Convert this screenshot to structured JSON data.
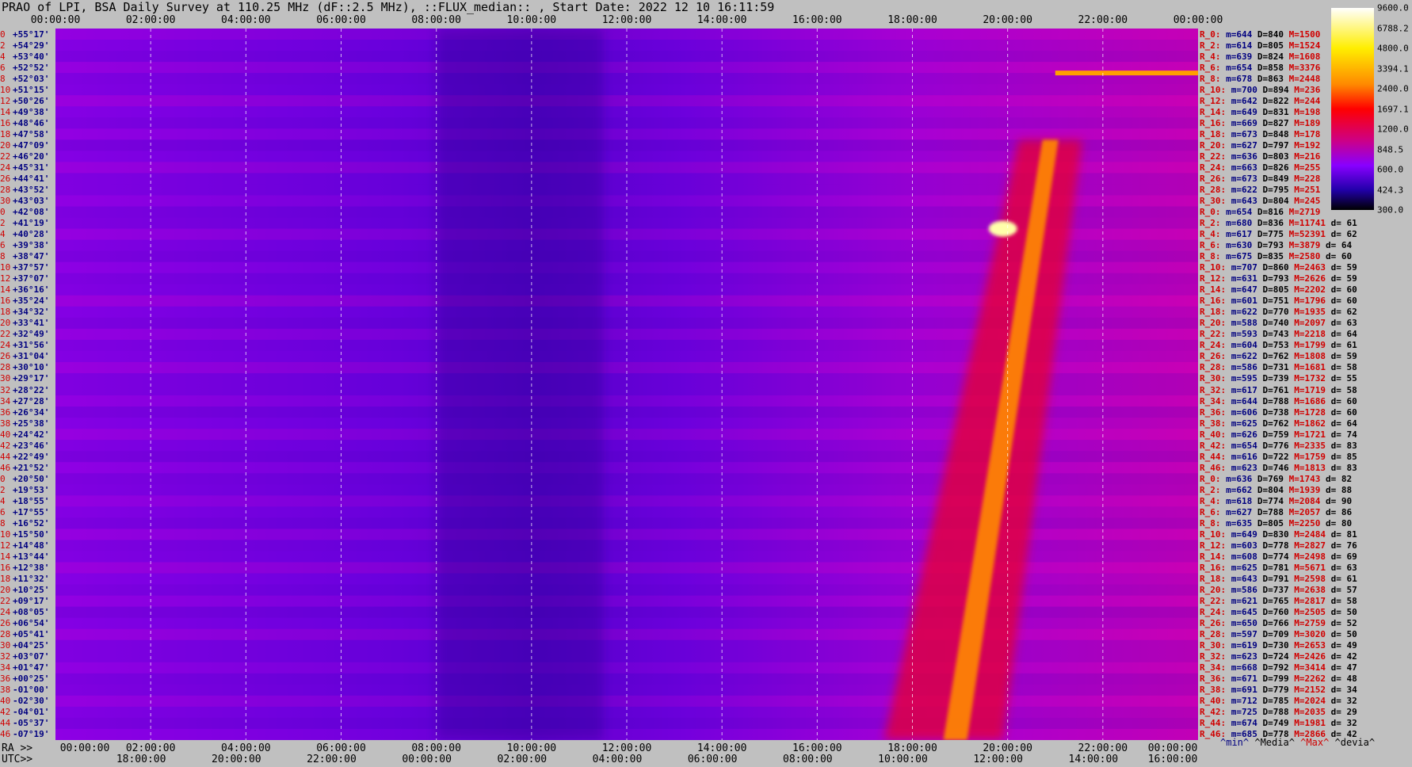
{
  "title": "PRAO of LPI, BSA Daily Survey at 110.25 MHz (dF::2.5 MHz), ::FLUX_median:: , Start Date: 2022 12 10 16:11:59",
  "top_ticks": [
    "00:00:00",
    "02:00:00",
    "04:00:00",
    "06:00:00",
    "08:00:00",
    "10:00:00",
    "12:00:00",
    "14:00:00",
    "16:00:00",
    "18:00:00",
    "20:00:00",
    "22:00:00",
    "00:00:00"
  ],
  "bottom_label_ra": "RA >>",
  "bottom_ticks_ra": [
    "00:00:00",
    "02:00:00",
    "04:00:00",
    "06:00:00",
    "08:00:00",
    "10:00:00",
    "12:00:00",
    "14:00:00",
    "16:00:00",
    "18:00:00",
    "20:00:00",
    "22:00:00",
    "00:00:00"
  ],
  "bottom_label_utc": "UTC>>",
  "bottom_ticks_utc": [
    "18:00:00",
    "20:00:00",
    "22:00:00",
    "00:00:00",
    "02:00:00",
    "04:00:00",
    "06:00:00",
    "08:00:00",
    "10:00:00",
    "12:00:00",
    "14:00:00",
    "16:00:00"
  ],
  "declinations": [
    {
      "i": "0",
      "d": "+55°17'"
    },
    {
      "i": "2",
      "d": "+54°29'"
    },
    {
      "i": "4",
      "d": "+53°40'"
    },
    {
      "i": "6",
      "d": "+52°52'"
    },
    {
      "i": "8",
      "d": "+52°03'"
    },
    {
      "i": "10",
      "d": "+51°15'"
    },
    {
      "i": "12",
      "d": "+50°26'"
    },
    {
      "i": "14",
      "d": "+49°38'"
    },
    {
      "i": "16",
      "d": "+48°46'"
    },
    {
      "i": "18",
      "d": "+47°58'"
    },
    {
      "i": "20",
      "d": "+47°09'"
    },
    {
      "i": "22",
      "d": "+46°20'"
    },
    {
      "i": "24",
      "d": "+45°31'"
    },
    {
      "i": "26",
      "d": "+44°41'"
    },
    {
      "i": "28",
      "d": "+43°52'"
    },
    {
      "i": "30",
      "d": "+43°03'"
    },
    {
      "i": "0",
      "d": "+42°08'"
    },
    {
      "i": "2",
      "d": "+41°19'"
    },
    {
      "i": "4",
      "d": "+40°28'"
    },
    {
      "i": "6",
      "d": "+39°38'"
    },
    {
      "i": "8",
      "d": "+38°47'"
    },
    {
      "i": "10",
      "d": "+37°57'"
    },
    {
      "i": "12",
      "d": "+37°07'"
    },
    {
      "i": "14",
      "d": "+36°16'"
    },
    {
      "i": "16",
      "d": "+35°24'"
    },
    {
      "i": "18",
      "d": "+34°32'"
    },
    {
      "i": "20",
      "d": "+33°41'"
    },
    {
      "i": "22",
      "d": "+32°49'"
    },
    {
      "i": "24",
      "d": "+31°56'"
    },
    {
      "i": "26",
      "d": "+31°04'"
    },
    {
      "i": "28",
      "d": "+30°10'"
    },
    {
      "i": "30",
      "d": "+29°17'"
    },
    {
      "i": "32",
      "d": "+28°22'"
    },
    {
      "i": "34",
      "d": "+27°28'"
    },
    {
      "i": "36",
      "d": "+26°34'"
    },
    {
      "i": "38",
      "d": "+25°38'"
    },
    {
      "i": "40",
      "d": "+24°42'"
    },
    {
      "i": "42",
      "d": "+23°46'"
    },
    {
      "i": "44",
      "d": "+22°49'"
    },
    {
      "i": "46",
      "d": "+21°52'"
    },
    {
      "i": "0",
      "d": "+20°50'"
    },
    {
      "i": "2",
      "d": "+19°53'"
    },
    {
      "i": "4",
      "d": "+18°55'"
    },
    {
      "i": "6",
      "d": "+17°55'"
    },
    {
      "i": "8",
      "d": "+16°52'"
    },
    {
      "i": "10",
      "d": "+15°50'"
    },
    {
      "i": "12",
      "d": "+14°48'"
    },
    {
      "i": "14",
      "d": "+13°44'"
    },
    {
      "i": "16",
      "d": "+12°38'"
    },
    {
      "i": "18",
      "d": "+11°32'"
    },
    {
      "i": "20",
      "d": "+10°25'"
    },
    {
      "i": "22",
      "d": "+09°17'"
    },
    {
      "i": "24",
      "d": "+08°05'"
    },
    {
      "i": "26",
      "d": "+06°54'"
    },
    {
      "i": "28",
      "d": "+05°41'"
    },
    {
      "i": "30",
      "d": "+04°25'"
    },
    {
      "i": "32",
      "d": "+03°07'"
    },
    {
      "i": "34",
      "d": "+01°47'"
    },
    {
      "i": "36",
      "d": "+00°25'"
    },
    {
      "i": "38",
      "d": "-01°00'"
    },
    {
      "i": "40",
      "d": "-02°30'"
    },
    {
      "i": "42",
      "d": "-04°01'"
    },
    {
      "i": "44",
      "d": "-05°37'"
    },
    {
      "i": "46",
      "d": "-07°19'"
    }
  ],
  "stats": [
    {
      "r": "R_0:",
      "m": "m=644",
      "md": "D=840",
      "mx": "M=1500",
      "d": ""
    },
    {
      "r": "R_2:",
      "m": "m=614",
      "md": "D=805",
      "mx": "M=1524",
      "d": ""
    },
    {
      "r": "R_4:",
      "m": "m=639",
      "md": "D=824",
      "mx": "M=1608",
      "d": ""
    },
    {
      "r": "R_6:",
      "m": "m=654",
      "md": "D=858",
      "mx": "M=3376",
      "d": ""
    },
    {
      "r": "R_8:",
      "m": "m=678",
      "md": "D=863",
      "mx": "M=2448",
      "d": ""
    },
    {
      "r": "R_10:",
      "m": "m=700",
      "md": "D=894",
      "mx": "M=236",
      "d": ""
    },
    {
      "r": "R_12:",
      "m": "m=642",
      "md": "D=822",
      "mx": "M=244",
      "d": ""
    },
    {
      "r": "R_14:",
      "m": "m=649",
      "md": "D=831",
      "mx": "M=198",
      "d": ""
    },
    {
      "r": "R_16:",
      "m": "m=669",
      "md": "D=827",
      "mx": "M=189",
      "d": ""
    },
    {
      "r": "R_18:",
      "m": "m=673",
      "md": "D=848",
      "mx": "M=178",
      "d": ""
    },
    {
      "r": "R_20:",
      "m": "m=627",
      "md": "D=797",
      "mx": "M=192",
      "d": ""
    },
    {
      "r": "R_22:",
      "m": "m=636",
      "md": "D=803",
      "mx": "M=216",
      "d": ""
    },
    {
      "r": "R_24:",
      "m": "m=663",
      "md": "D=826",
      "mx": "M=255",
      "d": ""
    },
    {
      "r": "R_26:",
      "m": "m=673",
      "md": "D=849",
      "mx": "M=228",
      "d": ""
    },
    {
      "r": "R_28:",
      "m": "m=622",
      "md": "D=795",
      "mx": "M=251",
      "d": ""
    },
    {
      "r": "R_30:",
      "m": "m=643",
      "md": "D=804",
      "mx": "M=245",
      "d": ""
    },
    {
      "r": "R_0:",
      "m": "m=654",
      "md": "D=816",
      "mx": "M=2719",
      "d": ""
    },
    {
      "r": "R_2:",
      "m": "m=680",
      "md": "D=836",
      "mx": "M=11741",
      "d": "d= 61"
    },
    {
      "r": "R_4:",
      "m": "m=617",
      "md": "D=775",
      "mx": "M=52391",
      "d": "d= 62"
    },
    {
      "r": "R_6:",
      "m": "m=630",
      "md": "D=793",
      "mx": "M=3879",
      "d": "d= 64"
    },
    {
      "r": "R_8:",
      "m": "m=675",
      "md": "D=835",
      "mx": "M=2580",
      "d": "d= 60"
    },
    {
      "r": "R_10:",
      "m": "m=707",
      "md": "D=860",
      "mx": "M=2463",
      "d": "d= 59"
    },
    {
      "r": "R_12:",
      "m": "m=631",
      "md": "D=793",
      "mx": "M=2626",
      "d": "d= 59"
    },
    {
      "r": "R_14:",
      "m": "m=647",
      "md": "D=805",
      "mx": "M=2202",
      "d": "d= 60"
    },
    {
      "r": "R_16:",
      "m": "m=601",
      "md": "D=751",
      "mx": "M=1796",
      "d": "d= 60"
    },
    {
      "r": "R_18:",
      "m": "m=622",
      "md": "D=770",
      "mx": "M=1935",
      "d": "d= 62"
    },
    {
      "r": "R_20:",
      "m": "m=588",
      "md": "D=740",
      "mx": "M=2097",
      "d": "d= 63"
    },
    {
      "r": "R_22:",
      "m": "m=593",
      "md": "D=743",
      "mx": "M=2218",
      "d": "d= 64"
    },
    {
      "r": "R_24:",
      "m": "m=604",
      "md": "D=753",
      "mx": "M=1799",
      "d": "d= 61"
    },
    {
      "r": "R_26:",
      "m": "m=622",
      "md": "D=762",
      "mx": "M=1808",
      "d": "d= 59"
    },
    {
      "r": "R_28:",
      "m": "m=586",
      "md": "D=731",
      "mx": "M=1681",
      "d": "d= 58"
    },
    {
      "r": "R_30:",
      "m": "m=595",
      "md": "D=739",
      "mx": "M=1732",
      "d": "d= 55"
    },
    {
      "r": "R_32:",
      "m": "m=617",
      "md": "D=761",
      "mx": "M=1719",
      "d": "d= 58"
    },
    {
      "r": "R_34:",
      "m": "m=644",
      "md": "D=788",
      "mx": "M=1686",
      "d": "d= 60"
    },
    {
      "r": "R_36:",
      "m": "m=606",
      "md": "D=738",
      "mx": "M=1728",
      "d": "d= 60"
    },
    {
      "r": "R_38:",
      "m": "m=625",
      "md": "D=762",
      "mx": "M=1862",
      "d": "d= 64"
    },
    {
      "r": "R_40:",
      "m": "m=626",
      "md": "D=759",
      "mx": "M=1721",
      "d": "d= 74"
    },
    {
      "r": "R_42:",
      "m": "m=654",
      "md": "D=776",
      "mx": "M=2335",
      "d": "d= 83"
    },
    {
      "r": "R_44:",
      "m": "m=616",
      "md": "D=722",
      "mx": "M=1759",
      "d": "d= 85"
    },
    {
      "r": "R_46:",
      "m": "m=623",
      "md": "D=746",
      "mx": "M=1813",
      "d": "d= 83"
    },
    {
      "r": "R_0:",
      "m": "m=636",
      "md": "D=769",
      "mx": "M=1743",
      "d": "d= 82"
    },
    {
      "r": "R_2:",
      "m": "m=662",
      "md": "D=804",
      "mx": "M=1939",
      "d": "d= 88"
    },
    {
      "r": "R_4:",
      "m": "m=618",
      "md": "D=774",
      "mx": "M=2084",
      "d": "d= 90"
    },
    {
      "r": "R_6:",
      "m": "m=627",
      "md": "D=788",
      "mx": "M=2057",
      "d": "d= 86"
    },
    {
      "r": "R_8:",
      "m": "m=635",
      "md": "D=805",
      "mx": "M=2250",
      "d": "d= 80"
    },
    {
      "r": "R_10:",
      "m": "m=649",
      "md": "D=830",
      "mx": "M=2484",
      "d": "d= 81"
    },
    {
      "r": "R_12:",
      "m": "m=603",
      "md": "D=778",
      "mx": "M=2827",
      "d": "d= 76"
    },
    {
      "r": "R_14:",
      "m": "m=608",
      "md": "D=774",
      "mx": "M=2498",
      "d": "d= 69"
    },
    {
      "r": "R_16:",
      "m": "m=625",
      "md": "D=781",
      "mx": "M=5671",
      "d": "d= 63"
    },
    {
      "r": "R_18:",
      "m": "m=643",
      "md": "D=791",
      "mx": "M=2598",
      "d": "d= 61"
    },
    {
      "r": "R_20:",
      "m": "m=586",
      "md": "D=737",
      "mx": "M=2638",
      "d": "d= 57"
    },
    {
      "r": "R_22:",
      "m": "m=621",
      "md": "D=765",
      "mx": "M=2817",
      "d": "d= 58"
    },
    {
      "r": "R_24:",
      "m": "m=645",
      "md": "D=760",
      "mx": "M=2505",
      "d": "d= 50"
    },
    {
      "r": "R_26:",
      "m": "m=650",
      "md": "D=766",
      "mx": "M=2759",
      "d": "d= 52"
    },
    {
      "r": "R_28:",
      "m": "m=597",
      "md": "D=709",
      "mx": "M=3020",
      "d": "d= 50"
    },
    {
      "r": "R_30:",
      "m": "m=619",
      "md": "D=730",
      "mx": "M=2653",
      "d": "d= 49"
    },
    {
      "r": "R_32:",
      "m": "m=623",
      "md": "D=724",
      "mx": "M=2426",
      "d": "d= 42"
    },
    {
      "r": "R_34:",
      "m": "m=668",
      "md": "D=792",
      "mx": "M=3414",
      "d": "d= 47"
    },
    {
      "r": "R_36:",
      "m": "m=671",
      "md": "D=799",
      "mx": "M=2262",
      "d": "d= 48"
    },
    {
      "r": "R_38:",
      "m": "m=691",
      "md": "D=779",
      "mx": "M=2152",
      "d": "d= 34"
    },
    {
      "r": "R_40:",
      "m": "m=712",
      "md": "D=785",
      "mx": "M=2024",
      "d": "d= 32"
    },
    {
      "r": "R_42:",
      "m": "m=725",
      "md": "D=788",
      "mx": "M=2035",
      "d": "d= 29"
    },
    {
      "r": "R_44:",
      "m": "m=674",
      "md": "D=749",
      "mx": "M=1981",
      "d": "d= 32"
    },
    {
      "r": "R_46:",
      "m": "m=685",
      "md": "D=778",
      "mx": "M=2866",
      "d": "d= 42"
    }
  ],
  "legend": {
    "min": "^min^",
    "median": "^Media^",
    "max": "^Max^",
    "dev": "^devia^"
  },
  "colorbar_labels": [
    "9600.0",
    "6788.2",
    "4800.0",
    "3394.1",
    "2400.0",
    "1697.1",
    "1200.0",
    "848.5",
    "600.0",
    "424.3",
    "300.0"
  ],
  "colors": {
    "background": "#c0c0c0",
    "low": "#000000",
    "mid_purple": "#7a00e6",
    "red": "#e60000",
    "orange": "#ff9900",
    "white": "#ffffff"
  },
  "chart_data": {
    "type": "heatmap",
    "title": "PRAO of LPI, BSA Daily Survey at 110.25 MHz (dF::2.5 MHz), ::FLUX_median:: , Start Date: 2022 12 10 16:11:59",
    "x_axis_top": "RA 00:00:00 – 24:00:00",
    "rows": 64,
    "scale": "log",
    "zlim": [
      300.0,
      9600.0
    ],
    "grid": true,
    "features": [
      {
        "kind": "diagonal-ridge",
        "ra_start_h": 18.4,
        "ra_end_h": 20.9,
        "row_start": 64,
        "row_end": 10,
        "peak": 2500
      },
      {
        "kind": "point-source",
        "ra_h": 19.9,
        "row": 18,
        "peak": 9600
      },
      {
        "kind": "horizontal-band",
        "row": 4,
        "ra_from_h": 21.0,
        "ra_to_h": 24.0,
        "peak": 3000
      },
      {
        "kind": "dim-band",
        "ra_from_h": 8.0,
        "ra_to_h": 11.5,
        "level": 450
      }
    ]
  }
}
